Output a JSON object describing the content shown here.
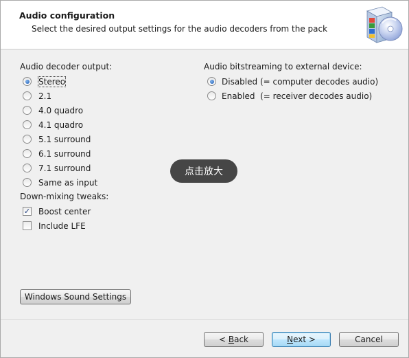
{
  "header": {
    "title": "Audio configuration",
    "subtitle": "Select the desired output settings for the audio decoders from the pack",
    "icon": "audio-speaker-cd-icon"
  },
  "decoder_output": {
    "label": "Audio decoder output:",
    "options": [
      "Stereo",
      "2.1",
      "4.0 quadro",
      "4.1 quadro",
      "5.1 surround",
      "6.1 surround",
      "7.1 surround",
      "Same as input"
    ],
    "selected": "Stereo"
  },
  "downmix": {
    "label": "Down-mixing tweaks:",
    "options": [
      {
        "label": "Boost center",
        "checked": true
      },
      {
        "label": "Include LFE",
        "checked": false
      }
    ]
  },
  "bitstreaming": {
    "label": "Audio bitstreaming to external device:",
    "options": [
      "Disabled (= computer decodes audio)",
      "Enabled  (= receiver decodes audio)"
    ],
    "selected": "Disabled (= computer decodes audio)"
  },
  "sound_settings_button": "Windows Sound Settings",
  "overlay": {
    "zoom_label": "点击放大"
  },
  "footer": {
    "back_prefix": "< ",
    "back_key": "B",
    "back_rest": "ack",
    "next_key": "N",
    "next_rest": "ext >",
    "cancel": "Cancel"
  }
}
